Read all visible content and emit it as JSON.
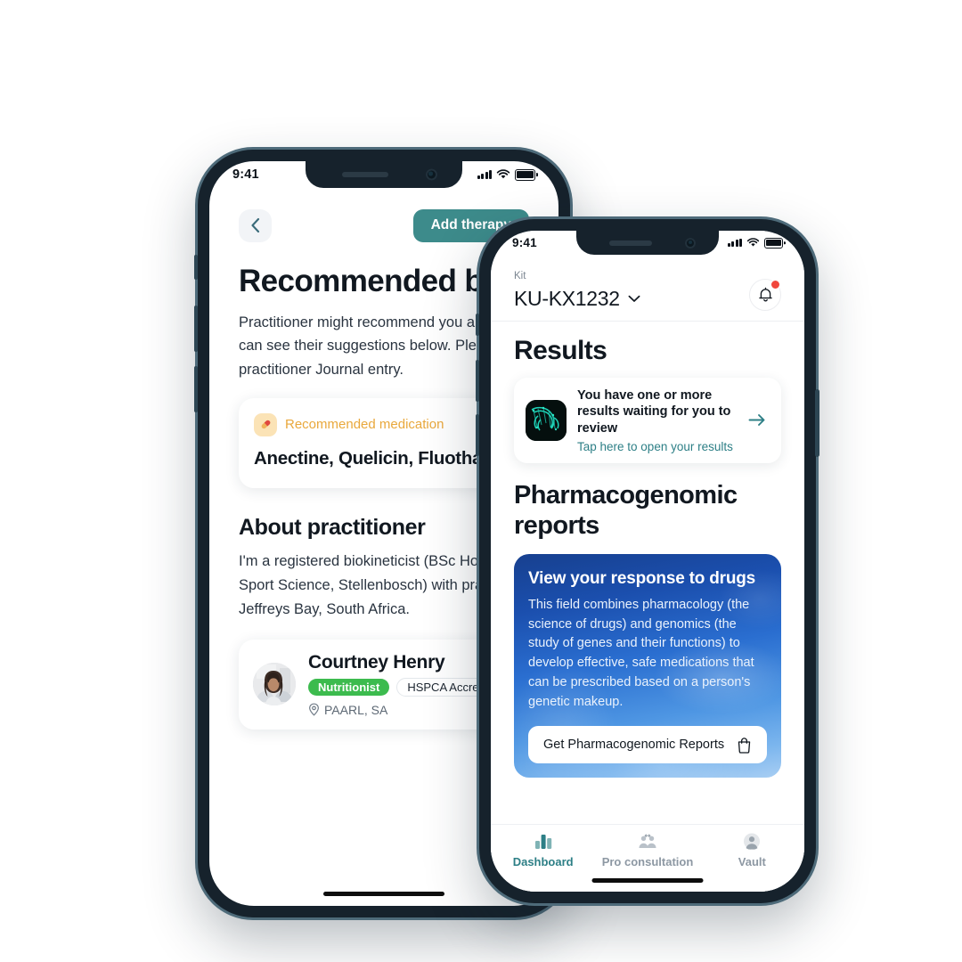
{
  "back_phone": {
    "status": {
      "time": "9:41",
      "signal_icon": "cellular-bars-icon",
      "wifi_icon": "wifi-icon",
      "battery_icon": "battery-icon"
    },
    "topbar": {
      "back_icon": "chevron-left-icon",
      "add_therapy_label": "Add therapy"
    },
    "title": "Recommended by a practitioner",
    "intro": "Practitioner might recommend you a drug or therapy. You can see their suggestions below. Please also consult the practitioner Journal entry.",
    "medication_card": {
      "icon": "pill-icon",
      "label": "Recommended medication",
      "drugs": "Anectine, Quelicin, Fluothane, Forane"
    },
    "about_heading": "About practitioner",
    "about_text": "I'm a registered biokineticist (BSc Hons Biokinetics, MSc Sport Science, Stellenbosch) with practices based in Jeffreys Bay, South Africa.",
    "practitioner": {
      "avatar": "practitioner-avatar",
      "name": "Courtney Henry",
      "tag_role": "Nutritionist",
      "tag_accreditation": "HSPCA Accredited",
      "location_icon": "map-pin-icon",
      "location": "PAARL, SA"
    }
  },
  "front_phone": {
    "status": {
      "time": "9:41",
      "signal_icon": "cellular-bars-icon",
      "wifi_icon": "wifi-icon",
      "battery_icon": "battery-icon"
    },
    "header": {
      "kit_label": "Kit",
      "kit_value": "KU-KX1232",
      "kit_chevron_icon": "chevron-down-icon",
      "bell_icon": "bell-icon",
      "bell_has_unread": true
    },
    "results": {
      "heading": "Results",
      "card": {
        "thumbnail": "dna-strand-thumbnail",
        "title": "You have one or more results waiting for you to review",
        "subtitle": "Tap here to open your results",
        "arrow_icon": "arrow-right-icon"
      }
    },
    "pharmaco": {
      "heading": "Pharmacogenomic reports",
      "card": {
        "title": "View your response to drugs",
        "body": "This field combines pharmacology (the science of drugs) and genomics (the study of genes and their functions) to develop effective, safe medications that can be prescribed based on a person's genetic makeup.",
        "cta_label": "Get Pharmacogenomic Reports",
        "cta_icon": "shopping-bag-icon"
      }
    },
    "tabs": [
      {
        "label": "Dashboard",
        "icon": "bar-chart-icon",
        "active": true
      },
      {
        "label": "Pro consultation",
        "icon": "people-icon",
        "active": false
      },
      {
        "label": "Vault",
        "icon": "person-circle-icon",
        "active": false
      }
    ]
  },
  "colors": {
    "teal": "#3d8b8b",
    "teal_link": "#2d7f86",
    "green_tag": "#3cbb4e",
    "amber": "#e9a83c",
    "blue_card_start": "#17408f",
    "blue_card_end": "#a8cef3",
    "notification_red": "#f0463c",
    "frame": "#16222c"
  }
}
